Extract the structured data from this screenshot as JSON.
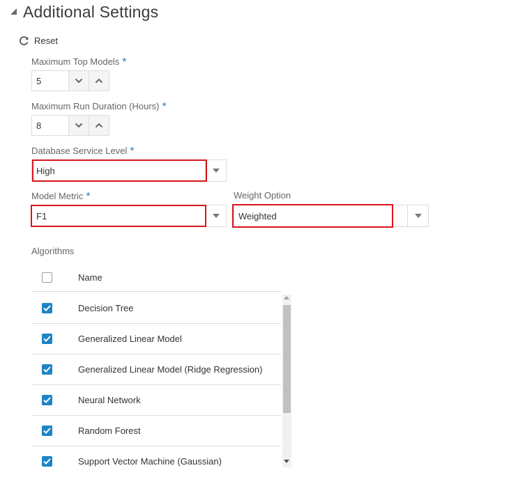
{
  "section": {
    "title": "Additional Settings",
    "reset_label": "Reset"
  },
  "required_marker": "*",
  "max_top_models": {
    "label": "Maximum Top Models",
    "value": "5"
  },
  "max_run_duration": {
    "label": "Maximum Run Duration (Hours)",
    "value": "8"
  },
  "db_service_level": {
    "label": "Database Service Level",
    "value": "High"
  },
  "model_metric": {
    "label": "Model Metric",
    "value": "F1"
  },
  "weight_option": {
    "label": "Weight Option",
    "value": "Weighted"
  },
  "algorithms": {
    "label": "Algorithms",
    "header_name": "Name",
    "rows": [
      {
        "name": "Decision Tree",
        "checked": true
      },
      {
        "name": "Generalized Linear Model",
        "checked": true
      },
      {
        "name": "Generalized Linear Model (Ridge Regression)",
        "checked": true
      },
      {
        "name": "Neural Network",
        "checked": true
      },
      {
        "name": "Random Forest",
        "checked": true
      },
      {
        "name": "Support Vector Machine (Gaussian)",
        "checked": true
      }
    ]
  },
  "colors": {
    "highlight_border": "#d9141c",
    "checkbox_checked": "#1e84c6",
    "required_marker": "#2d7fc4"
  }
}
